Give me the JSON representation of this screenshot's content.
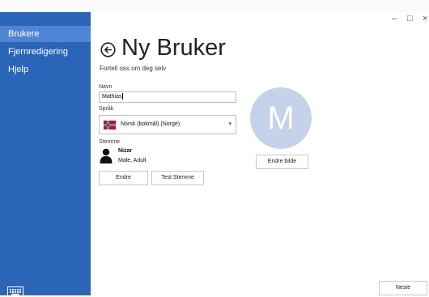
{
  "sidebar": {
    "items": [
      {
        "label": "Brukere"
      },
      {
        "label": "Fjernredigering"
      },
      {
        "label": "Hjelp"
      }
    ]
  },
  "window": {
    "minimize": "–",
    "maximize": "□",
    "close": "×"
  },
  "header": {
    "title": "Ny Bruker",
    "subtitle": "Fortell oss om deg selv"
  },
  "form": {
    "name_label": "Navn",
    "name_value": "Mathias",
    "language_label": "Språk",
    "language_value": "Norsk (bokmål) (Norge)",
    "voice_label": "Stemme",
    "voice_name": "Nizar",
    "voice_desc": "Male, Adult",
    "edit_button": "Endre",
    "test_voice_button": "Test Stemme"
  },
  "avatar": {
    "letter": "M",
    "change_image_button": "Endre bilde"
  },
  "footer": {
    "next_button": "Neste"
  },
  "colors": {
    "sidebar": "#2b65b8",
    "sidebar_active": "#4f86d3",
    "avatar_bg": "#c4d2ea"
  }
}
